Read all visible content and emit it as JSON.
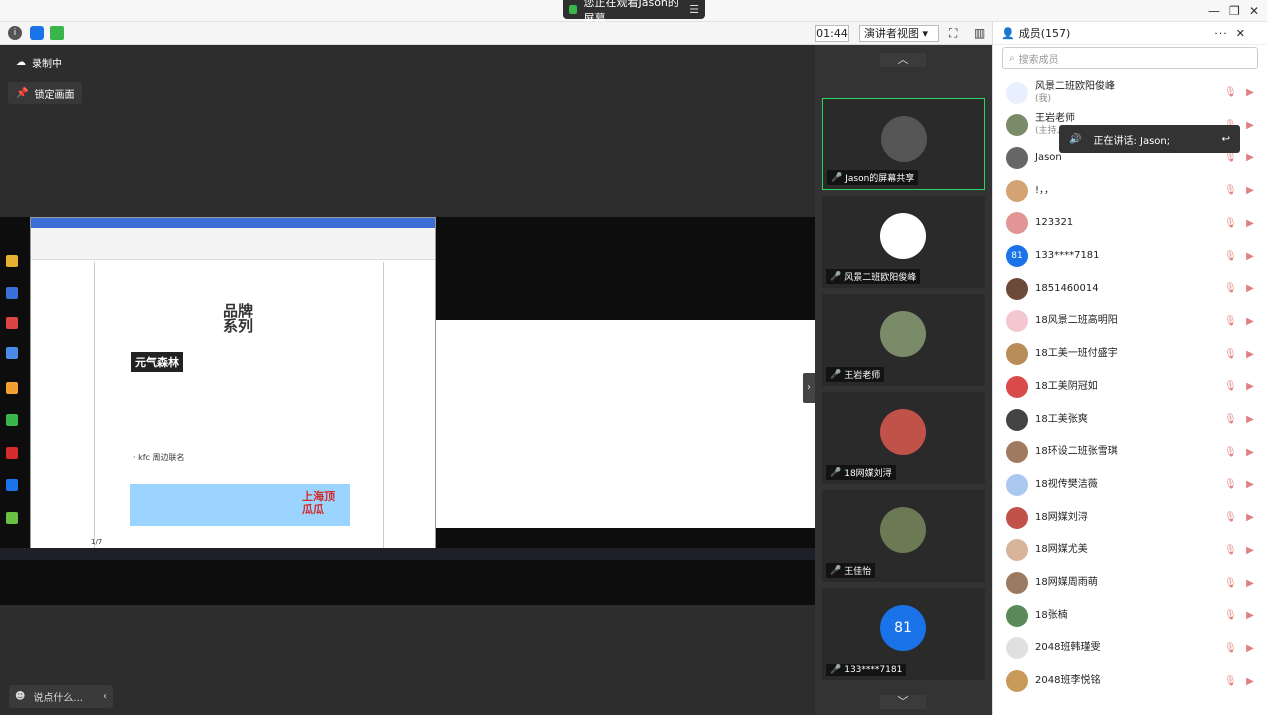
{
  "titlebar": {
    "share_status": "您正在观看Jason的屏幕",
    "menu_icon": "list-icon"
  },
  "toolbar": {
    "timer": "01:44",
    "view_mode": "演讲者视图"
  },
  "stage": {
    "recording_label": "录制中",
    "lock_label": "锁定画面",
    "chat_placeholder": "说点什么..."
  },
  "shared_screen": {
    "pdf_brand": "品牌系列",
    "pdf_tag": "元气森林",
    "pdf_kfc": "· kfc 周边联名",
    "pdf_banner": "上海顶瓜瓜",
    "page_indicator": "1/7"
  },
  "video_tiles": [
    {
      "label": "Jason的屏幕共享",
      "color": "#555555",
      "text": ""
    },
    {
      "label": "风景二班欧阳俊峰",
      "color": "#ffffff",
      "text": ""
    },
    {
      "label": "王岩老师",
      "color": "#7a8b6a",
      "text": ""
    },
    {
      "label": "18网媒刘浔",
      "color": "#c0524a",
      "text": ""
    },
    {
      "label": "王佳怡",
      "color": "#6b7a55",
      "text": ""
    },
    {
      "label": "133****7181",
      "color": "#1a73e8",
      "text": "81"
    }
  ],
  "members": {
    "title": "成员(157)",
    "search_placeholder": "搜索成员",
    "speaking": "正在讲话: Jason;",
    "list": [
      {
        "name": "风景二班欧阳俊峰",
        "sub": "(我)",
        "color": "#e8f0ff",
        "av": ""
      },
      {
        "name": "王岩老师",
        "sub": "(主持人)",
        "color": "#7a8b6a",
        "av": ""
      },
      {
        "name": "Jason",
        "sub": "",
        "color": "#666666",
        "av": ""
      },
      {
        "name": "!，，",
        "sub": "",
        "color": "#d4a373",
        "av": ""
      },
      {
        "name": "123321",
        "sub": "",
        "color": "#e29595",
        "av": ""
      },
      {
        "name": "133****7181",
        "sub": "",
        "color": "#1a73e8",
        "av": "81"
      },
      {
        "name": "1851460014",
        "sub": "",
        "color": "#6b4a3a",
        "av": ""
      },
      {
        "name": "18风景二班高明阳",
        "sub": "",
        "color": "#f3c6d0",
        "av": ""
      },
      {
        "name": "18工美一班付盛宇",
        "sub": "",
        "color": "#b98c5a",
        "av": ""
      },
      {
        "name": "18工美阴冠如",
        "sub": "",
        "color": "#d94a4a",
        "av": ""
      },
      {
        "name": "18工美张爽",
        "sub": "",
        "color": "#444444",
        "av": ""
      },
      {
        "name": "18环设二班张雪琪",
        "sub": "",
        "color": "#a07a60",
        "av": ""
      },
      {
        "name": "18视传樊洁薇",
        "sub": "",
        "color": "#aac8f0",
        "av": ""
      },
      {
        "name": "18网媒刘浔",
        "sub": "",
        "color": "#c0524a",
        "av": ""
      },
      {
        "name": "18网媒尤美",
        "sub": "",
        "color": "#d8b49a",
        "av": ""
      },
      {
        "name": "18网媒周雨萌",
        "sub": "",
        "color": "#9a7a60",
        "av": ""
      },
      {
        "name": "18张楠",
        "sub": "",
        "color": "#5a8a5a",
        "av": ""
      },
      {
        "name": "2048班韩瑾雯",
        "sub": "",
        "color": "#e0e0e0",
        "av": ""
      },
      {
        "name": "2048班李悦铭",
        "sub": "",
        "color": "#c89a5a",
        "av": ""
      }
    ]
  }
}
